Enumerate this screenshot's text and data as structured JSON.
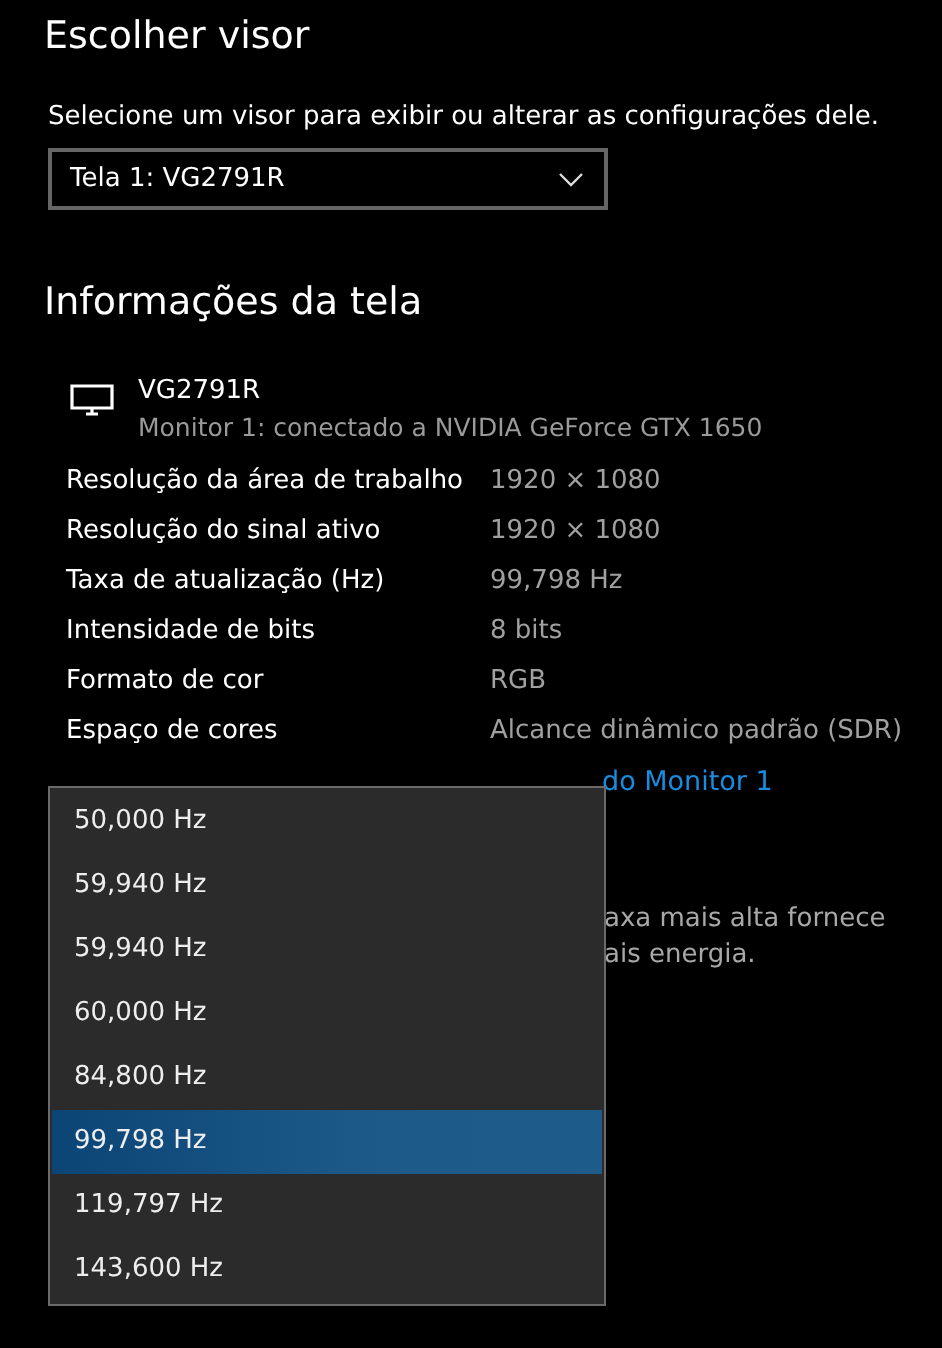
{
  "choose_display": {
    "title": "Escolher visor",
    "instruction": "Selecione um visor para exibir ou alterar as configurações dele.",
    "display_select": {
      "value": "Tela 1: VG2791R"
    }
  },
  "display_info": {
    "title": "Informações da tela",
    "monitor": {
      "name": "VG2791R",
      "description": "Monitor 1: conectado a NVIDIA GeForce GTX 1650"
    },
    "rows": [
      {
        "label": "Resolução da área de trabalho",
        "value": "1920 × 1080"
      },
      {
        "label": "Resolução do sinal ativo",
        "value": "1920 × 1080"
      },
      {
        "label": "Taxa de atualização (Hz)",
        "value": "99,798 Hz"
      },
      {
        "label": "Intensidade de bits",
        "value": "8 bits"
      },
      {
        "label": "Formato de cor",
        "value": "RGB"
      },
      {
        "label": "Espaço de cores",
        "value": "Alcance dinâmico padrão (SDR)"
      }
    ],
    "link_partial": "do Monitor 1",
    "note_partial": [
      "axa mais alta fornece",
      "ais energia."
    ]
  },
  "refresh_menu": [
    {
      "label": "50,000 Hz",
      "selected": false
    },
    {
      "label": "59,940 Hz",
      "selected": false
    },
    {
      "label": "59,940 Hz",
      "selected": false
    },
    {
      "label": "60,000 Hz",
      "selected": false
    },
    {
      "label": "84,800 Hz",
      "selected": false
    },
    {
      "label": "99,798 Hz",
      "selected": true
    },
    {
      "label": "119,797 Hz",
      "selected": false
    },
    {
      "label": "143,600 Hz",
      "selected": false
    }
  ]
}
